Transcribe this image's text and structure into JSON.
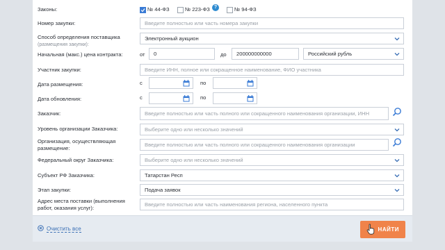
{
  "laws": {
    "label": "Законы:",
    "items": [
      {
        "label": "№ 44-ФЗ",
        "checked": true
      },
      {
        "label": "№ 223-ФЗ",
        "checked": false
      },
      {
        "label": "№ 94-ФЗ",
        "checked": false
      }
    ]
  },
  "purchase_number": {
    "label": "Номер закупки:",
    "placeholder": "Введите полностью или часть номера закупки"
  },
  "supplier_method": {
    "label": "Способ определения поставщика",
    "sublabel": "(размещения закупки):",
    "value": "Электронный аукцион"
  },
  "price": {
    "label": "Начальная (макс.) цена контракта:",
    "from_label": "от",
    "from_value": "0",
    "to_label": "до",
    "to_value": "200000000000",
    "currency": "Российский рубль"
  },
  "participant": {
    "label": "Участник закупки:",
    "placeholder": "Введите ИНН, полное или сокращенное наименование, ФИО участника"
  },
  "placement_date": {
    "label": "Дата размещения:",
    "from_label": "с",
    "to_label": "по"
  },
  "update_date": {
    "label": "Дата обновления:",
    "from_label": "с",
    "to_label": "по"
  },
  "customer": {
    "label": "Заказчик:",
    "placeholder": "Введите полностью или часть полного или сокращенного наименования организации, ИНН"
  },
  "customer_level": {
    "label": "Уровень организации Заказчика:",
    "placeholder": "Выберите одно или несколько значений"
  },
  "placing_org": {
    "label_line1": "Организация, осуществляющая",
    "label_line2": "размещение:",
    "placeholder": "Введите полностью или часть полного или сокращенного наименования организации"
  },
  "federal_district": {
    "label": "Федеральный округ Заказчика:",
    "placeholder": "Выберите одно или несколько значений"
  },
  "subject": {
    "label": "Субъект РФ Заказчика:",
    "value": "Татарстан Респ"
  },
  "stage": {
    "label": "Этап закупки:",
    "value": "Подача заявок"
  },
  "delivery_address": {
    "label_line1": "Адрес места поставки (выполнения",
    "label_line2": "работ, оказания услуг):",
    "placeholder": "Введите полностью или часть наименования региона, населенного пункта"
  },
  "footer": {
    "clear_label": "Очистить все",
    "find_label": "НАЙТИ"
  },
  "colors": {
    "accent": "#3a7bd5",
    "find_button": "#f0834a",
    "link": "#3a6fb5",
    "help_badge": "#2e8bd0"
  }
}
